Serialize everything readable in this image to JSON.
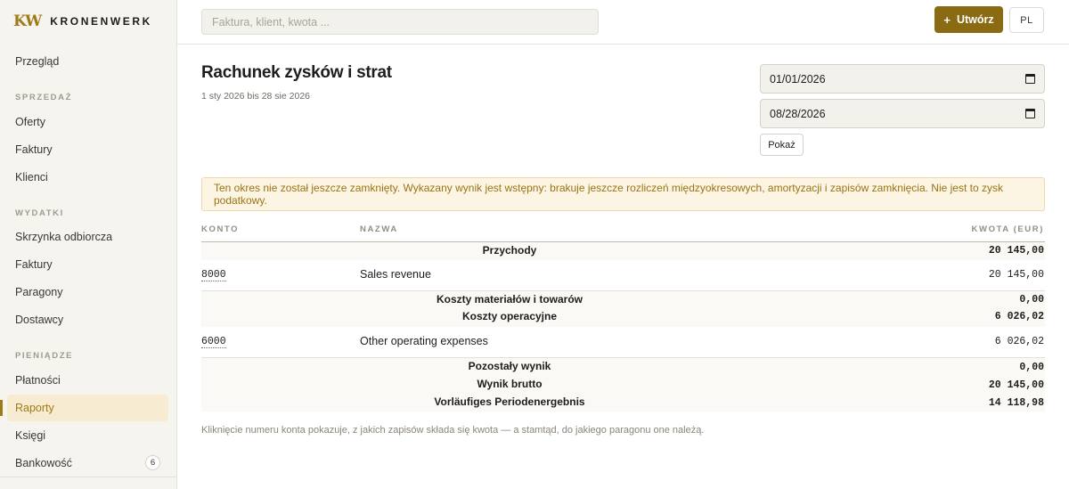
{
  "brand": {
    "mark": "KW",
    "name": "KRONENWERK"
  },
  "sidebar": {
    "overview": "Przegląd",
    "sections": [
      {
        "title": "SPRZEDAŻ",
        "items": [
          "Oferty",
          "Faktury",
          "Klienci"
        ]
      },
      {
        "title": "WYDATKI",
        "items": [
          "Skrzynka odbiorcza",
          "Faktury",
          "Paragony",
          "Dostawcy"
        ]
      },
      {
        "title": "PIENIĄDZE",
        "items": [
          "Płatności",
          "Raporty",
          "Księgi",
          "Bankowość"
        ]
      }
    ],
    "active_item": "Raporty",
    "banking_badge": "6"
  },
  "topbar": {
    "search_placeholder": "Faktura, klient, kwota ...",
    "create_label": "Utwórz",
    "create_icon": "plus-icon",
    "language": "PL"
  },
  "report": {
    "title": "Rachunek zysków i strat",
    "period": "1 sty 2026 bis 28 sie 2026",
    "date_from": "01/01/2026",
    "date_to": "08/28/2026",
    "show_label": "Pokaż",
    "notice": "Ten okres nie został jeszcze zamknięty. Wykazany wynik jest wstępny: brakuje jeszcze rozliczeń międzyokresowych, amortyzacji i zapisów zamknięcia. Nie jest to zysk podatkowy.",
    "columns": {
      "account": "KONTO",
      "name": "NAZWA",
      "amount": "KWOTA (EUR)"
    },
    "rows": {
      "revenue_group": {
        "label": "Przychody",
        "amount": "20 145,00"
      },
      "revenue_line": {
        "account": "8000",
        "name": "Sales revenue",
        "amount": "20 145,00"
      },
      "materials_group": {
        "label": "Koszty materiałów i towarów",
        "amount": "0,00"
      },
      "operating_group": {
        "label": "Koszty operacyjne",
        "amount": "6 026,02"
      },
      "operating_line": {
        "account": "6000",
        "name": "Other operating expenses",
        "amount": "6 026,02"
      },
      "other_result": {
        "label": "Pozostały wynik",
        "amount": "0,00"
      },
      "gross_result": {
        "label": "Wynik brutto",
        "amount": "20 145,00"
      },
      "preliminary_result": {
        "label": "Vorläufiges Periodenergebnis",
        "amount": "14 118,98"
      }
    },
    "footnote": "Kliknięcie numeru konta pokazuje, z jakich zapisów składa się kwota — a stamtąd, do jakiego paragonu one należą."
  },
  "colors": {
    "accent": "#8a6a12",
    "accent_light": "#f7ecd2",
    "notice_bg": "#fcf5e3",
    "notice_text": "#9a7414"
  }
}
